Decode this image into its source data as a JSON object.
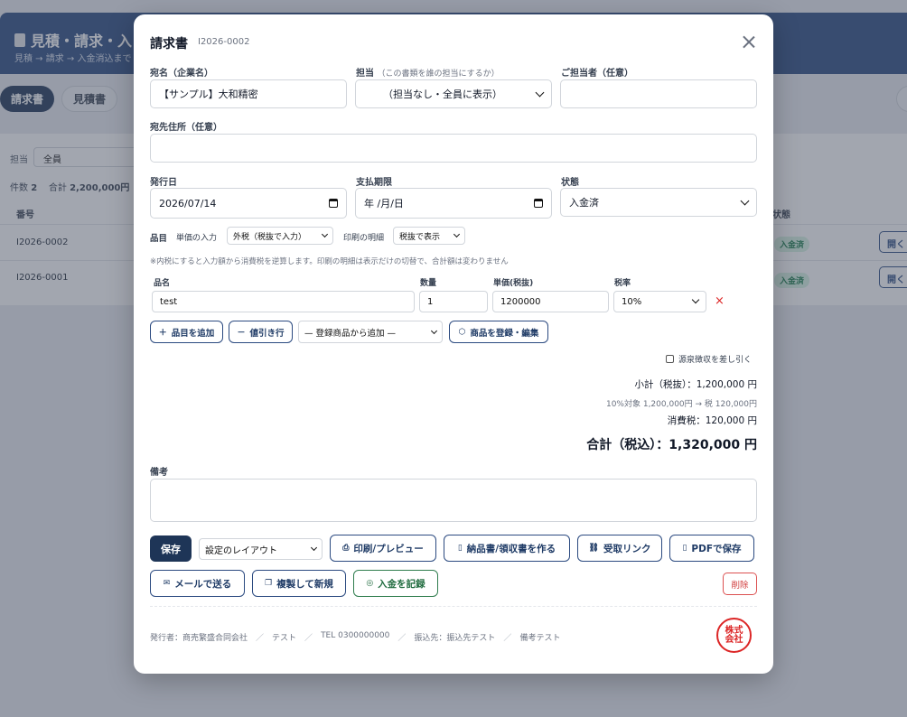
{
  "background": {
    "header_title": "見積・請求・入",
    "header_sub": "見積 → 請求 → 入金消込まで",
    "tabs": [
      "請求書",
      "見積書"
    ],
    "filter_label": "担当",
    "filter_value": "全員",
    "count_label": "件数",
    "count_value": "2",
    "total_label": "合計",
    "total_value": "2,200,000円",
    "col_number": "番号",
    "col_status": "状態",
    "rows": [
      {
        "number": "I2026-0002",
        "status": "入金済",
        "action": "開く"
      },
      {
        "number": "I2026-0001",
        "status": "入金済",
        "action": "開く"
      }
    ]
  },
  "modal": {
    "title": "請求書",
    "doc_number": "I2026-0002",
    "recipient_label": "宛名（企業名）",
    "recipient_value": "【サンプル】大和精密",
    "assignee_label": "担当",
    "assignee_hint": "（この書類を誰の担当にするか）",
    "assignee_value": "（担当なし・全員に表示）",
    "contact_label": "ご担当者（任意）",
    "contact_value": "",
    "address_label": "宛先住所（任意）",
    "address_value": "",
    "issue_date_label": "発行日",
    "issue_date_value": "2026/07/14",
    "due_date_label": "支払期限",
    "due_date_value": "年 /月/日",
    "status_label": "状態",
    "status_value": "入金済",
    "items_label": "品目",
    "unit_price_input_label": "単価の入力",
    "unit_price_input_value": "外税（税抜で入力）",
    "print_detail_label": "印刷の明細",
    "print_detail_value": "税抜で表示",
    "items_note": "※内税にすると入力額から消費税を逆算します。印刷の明細は表示だけの切替で、合計額は変わりません",
    "col_name": "品名",
    "col_qty": "数量",
    "col_price": "単価(税抜)",
    "col_tax": "税率",
    "item": {
      "name": "test",
      "qty": "1",
      "price": "1200000",
      "tax": "10%"
    },
    "delete_row_glyph": "×",
    "add_item": "品目を追加",
    "discount_row": "値引き行",
    "registered_item_select": "— 登録商品から追加 —",
    "manage_products": "商品を登録・編集",
    "withholding_label": "源泉徴収を差し引く",
    "subtotal": "小計（税抜）：1,200,000 円",
    "tax_breakdown": "10%対象 1,200,000円 → 税 120,000円",
    "tax_total": "消費税：120,000 円",
    "grand_total": "合計（税込）：1,320,000 円",
    "remarks_label": "備考",
    "remarks_value": "",
    "save": "保存",
    "layout_select": "設定のレイアウト",
    "print_preview": "印刷/プレビュー",
    "make_delivery": "納品書/領収書を作る",
    "receive_link": "受取リンク",
    "save_pdf": "PDFで保存",
    "send_mail": "メールで送る",
    "duplicate": "複製して新規",
    "record_payment": "入金を記録",
    "delete": "削除",
    "footer": {
      "issuer": "発行者：商売繁盛合同会社",
      "person": "テスト",
      "tel": "TEL 0300000000",
      "bank": "振込先：振込先テスト",
      "note": "備考テスト"
    },
    "seal_text": [
      "株式",
      "会社"
    ]
  },
  "colors": {
    "primary": "#1e3557",
    "header": "#2b4a80",
    "danger": "#dc2626",
    "success": "#2f7d4e"
  }
}
